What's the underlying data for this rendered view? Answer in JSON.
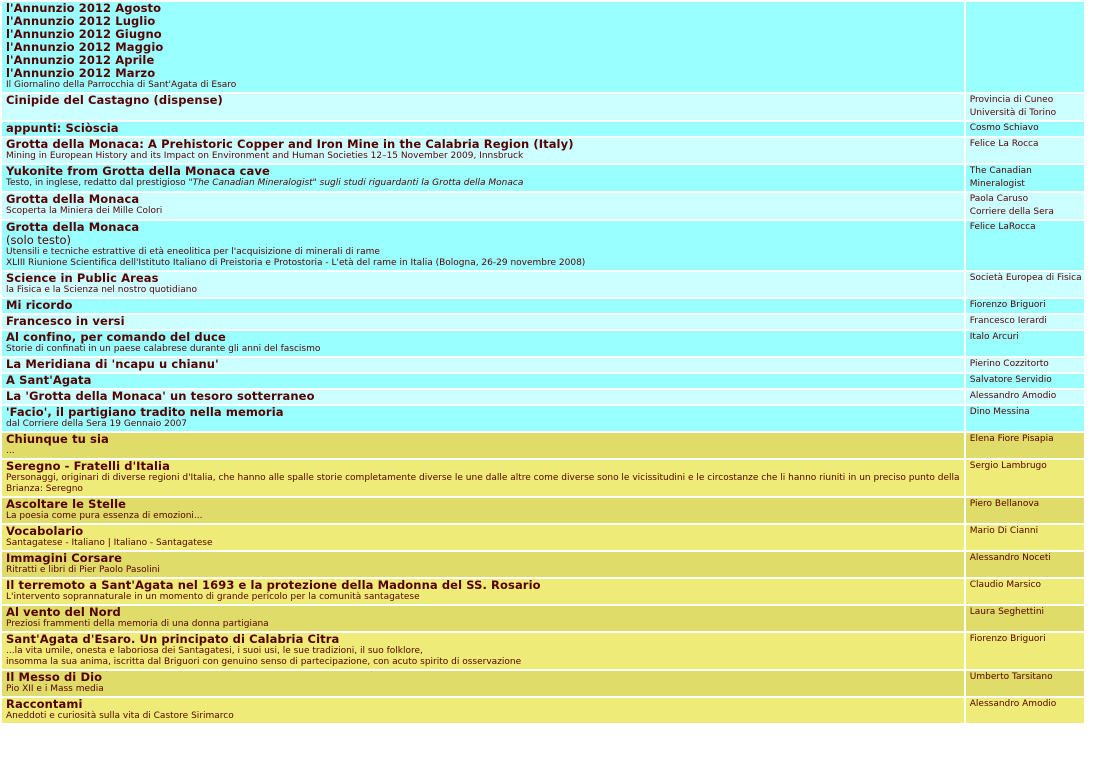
{
  "rows": [
    {
      "style": "cyan",
      "titles": [
        "l'Annunzio 2012 Agosto",
        "l'Annunzio 2012 Luglio",
        "l'Annunzio 2012 Giugno",
        "l'Annunzio 2012 Maggio",
        "l'Annunzio 2012 Aprile",
        "l'Annunzio 2012 Marzo"
      ],
      "sub": [
        "Il Giornalino della Parrocchia di Sant'Agata di Esaro"
      ],
      "author": []
    },
    {
      "style": "cyan-lt",
      "titles": [
        "Cinipide del Castagno (dispense)"
      ],
      "sub": [],
      "author": [
        "Provincia di Cuneo",
        "Università di Torino"
      ]
    },
    {
      "style": "cyan",
      "titles": [
        "appunti: Sciòscia"
      ],
      "sub": [],
      "author": [
        "Cosmo Schiavo"
      ]
    },
    {
      "style": "cyan-lt",
      "titles": [
        "Grotta della Monaca: A Prehistoric Copper and Iron Mine in the Calabria Region (Italy)"
      ],
      "sub": [
        "Mining in European History and its Impact on Environment and Human Societies 12–15 November 2009, Innsbruck"
      ],
      "author": [
        "Felice La Rocca"
      ]
    },
    {
      "style": "cyan",
      "titles": [
        "Yukonite from Grotta della Monaca cave"
      ],
      "sub_rich": {
        "before": "Testo, in inglese, redatto dal prestigioso ",
        "em": "\"The Canadian Mineralogist\" sugli studi riguardanti la Grotta della Monaca"
      },
      "sub": [],
      "author": [
        "The Canadian",
        "Mineralogist"
      ]
    },
    {
      "style": "cyan-lt",
      "titles": [
        "Grotta della Monaca"
      ],
      "sub": [
        "Scoperta la Miniera dei Mille Colori"
      ],
      "author": [
        "Paola Caruso",
        "Corriere della Sera"
      ]
    },
    {
      "style": "cyan",
      "titles": [
        "Grotta della Monaca"
      ],
      "lines": [
        "(solo testo)"
      ],
      "sub": [
        "Utensili e tecniche estrattive di età eneolitica per l'acquisizione di minerali di rame",
        "XLIII Riunione Scientifica dell'Istituto Italiano di Preistoria e Protostoria - L'età del rame in Italia (Bologna, 26-29 novembre 2008)"
      ],
      "author": [
        "Felice LaRocca"
      ]
    },
    {
      "style": "cyan-lt",
      "titles": [
        "Science in Public Areas"
      ],
      "sub": [
        "la Fisica e la Scienza nel nostro quotidiano"
      ],
      "author": [
        "Società Europea di Fisica"
      ]
    },
    {
      "style": "cyan",
      "titles": [
        "Mi ricordo"
      ],
      "sub": [],
      "author": [
        "Fiorenzo Briguori"
      ]
    },
    {
      "style": "cyan-lt",
      "titles": [
        "Francesco in versi"
      ],
      "sub": [],
      "author": [
        "Francesco Ierardi"
      ]
    },
    {
      "style": "cyan",
      "titles": [
        "Al confino, per comando del duce"
      ],
      "sub": [
        "Storie di confinati in un paese calabrese durante gli anni del fascismo"
      ],
      "author": [
        "Italo Arcuri"
      ]
    },
    {
      "style": "cyan-lt",
      "titles": [
        "La Meridiana di 'ncapu u chianu'"
      ],
      "sub": [],
      "author": [
        "Pierino Cozzitorto"
      ]
    },
    {
      "style": "cyan",
      "titles": [
        "A Sant'Agata"
      ],
      "sub": [],
      "author": [
        "Salvatore Servidio"
      ]
    },
    {
      "style": "cyan-lt",
      "titles": [
        "La 'Grotta della Monaca' un tesoro sotterraneo"
      ],
      "sub": [],
      "author": [
        "Alessandro Amodio"
      ]
    },
    {
      "style": "cyan",
      "titles": [
        "'Facio', il partigiano tradito nella memoria"
      ],
      "sub": [
        "dal Corriere della Sera 19 Gennaio 2007"
      ],
      "author": [
        "Dino Messina"
      ]
    },
    {
      "style": "yel",
      "titles": [
        "Chiunque tu sia"
      ],
      "sub": [
        "..."
      ],
      "author": [
        "Elena Fiore Pisapia"
      ]
    },
    {
      "style": "yel-lt",
      "titles": [
        "Seregno - Fratelli d'Italia"
      ],
      "sub": [
        "Personaggi, originari di diverse regioni d'Italia, che hanno alle spalle storie completamente diverse le une dalle altre come diverse sono le vicissitudini e le circostanze che li hanno riuniti in un preciso punto della Brianza: Seregno"
      ],
      "author": [
        "Sergio Lambrugo"
      ]
    },
    {
      "style": "yel",
      "titles": [
        "Ascoltare le Stelle"
      ],
      "sub": [
        "La poesia come pura essenza di emozioni..."
      ],
      "author": [
        "Piero Bellanova"
      ]
    },
    {
      "style": "yel-lt",
      "titles": [
        "Vocabolario"
      ],
      "sub": [
        "Santagatese - Italiano | Italiano - Santagatese"
      ],
      "author": [
        "Mario Di Cianni"
      ]
    },
    {
      "style": "yel",
      "titles": [
        "Immagini Corsare"
      ],
      "sub": [
        "Ritratti e libri di Pier Paolo Pasolini"
      ],
      "author": [
        "Alessandro Noceti"
      ]
    },
    {
      "style": "yel-lt",
      "titles": [
        "Il terremoto a Sant'Agata nel 1693 e la protezione della Madonna del SS. Rosario"
      ],
      "sub": [
        "L'intervento soprannaturale in un momento di grande pericolo per la comunità santagatese"
      ],
      "author": [
        "Claudio Marsico"
      ]
    },
    {
      "style": "yel",
      "titles": [
        "Al vento del Nord"
      ],
      "sub": [
        "Preziosi frammenti della memoria di una donna partigiana"
      ],
      "author": [
        "Laura Seghettini"
      ]
    },
    {
      "style": "yel-lt",
      "titles": [
        "Sant'Agata d'Esaro. Un principato di Calabria Citra"
      ],
      "sub": [
        "...la vita umile, onesta e laboriosa dei Santagatesi, i suoi usi, le sue tradizioni, il suo folklore,",
        "insomma la sua anima, iscritta dal Briguori con genuino senso di partecipazione, con acuto spirito di osservazione"
      ],
      "author": [
        "Fiorenzo Briguori"
      ]
    },
    {
      "style": "yel",
      "titles": [
        "Il Messo di Dio"
      ],
      "sub": [
        "Pio XII e i Mass media"
      ],
      "author": [
        "Umberto Tarsitano"
      ]
    },
    {
      "style": "yel-lt",
      "titles": [
        "Raccontami"
      ],
      "sub": [
        "Aneddoti e curiosità sulla vita di Castore Sirimarco"
      ],
      "author": [
        "Alessandro Amodio"
      ]
    }
  ]
}
